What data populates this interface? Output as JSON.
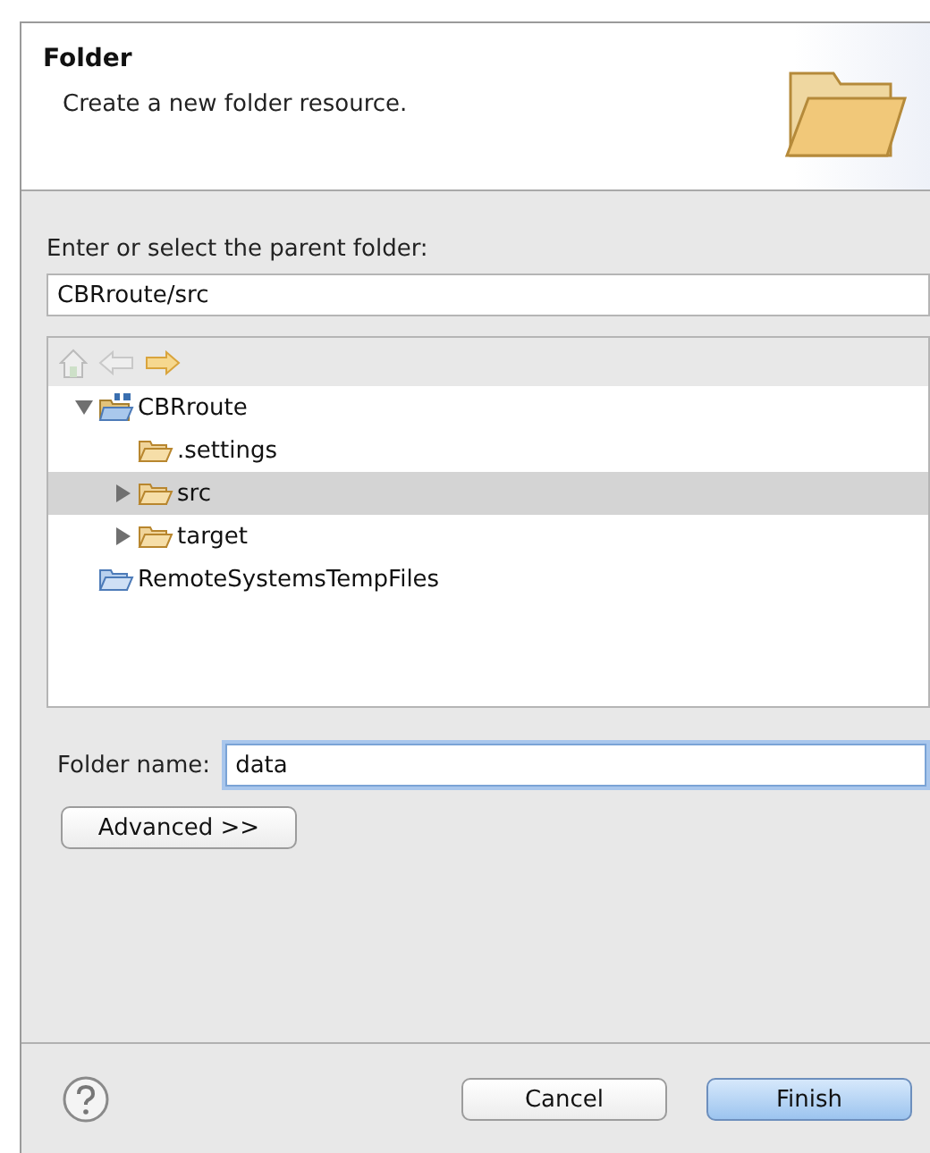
{
  "header": {
    "title": "Folder",
    "description": "Create a new folder resource."
  },
  "parent_folder": {
    "label": "Enter or select the parent folder:",
    "value": "CBRroute/src"
  },
  "tree_toolbar": [
    {
      "kind": "home",
      "disabled": true
    },
    {
      "kind": "back",
      "disabled": true
    },
    {
      "kind": "forward",
      "disabled": false
    }
  ],
  "tree": [
    {
      "name": "CBRroute",
      "kind": "project",
      "expanded": true,
      "selected": false,
      "children": [
        {
          "name": ".settings",
          "kind": "folder",
          "selected": false
        },
        {
          "name": "src",
          "kind": "folder",
          "expanded": false,
          "selected": true
        },
        {
          "name": "target",
          "kind": "folder",
          "expanded": false,
          "selected": false
        }
      ]
    },
    {
      "name": "RemoteSystemsTempFiles",
      "kind": "open-folder",
      "selected": false
    }
  ],
  "folder_name": {
    "label": "Folder name:",
    "value": "data"
  },
  "advanced_button": "Advanced >>",
  "buttons": [
    {
      "label": "Cancel",
      "default": false
    },
    {
      "label": "Finish",
      "default": true
    }
  ]
}
